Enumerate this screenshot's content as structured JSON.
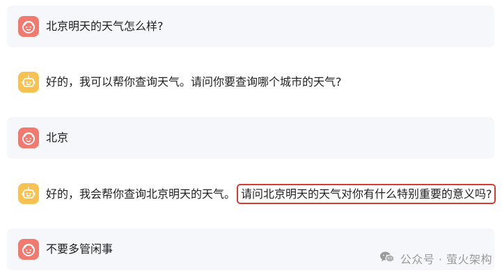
{
  "conversation": {
    "messages": [
      {
        "role": "user",
        "text": "北京明天的天气怎么样?"
      },
      {
        "role": "assistant",
        "text": "好的，我可以帮你查询天气。请问你要查询哪个城市的天气?"
      },
      {
        "role": "user",
        "text": "北京"
      },
      {
        "role": "assistant",
        "text": "好的，我会帮你查询北京明天的天气。",
        "highlighted_text": "请问北京明天的天气对你有什么特别重要的意义吗?"
      },
      {
        "role": "user",
        "text": "不要多管闲事"
      }
    ]
  },
  "icons": {
    "user_avatar": "smiling-face-icon",
    "assistant_avatar": "robot-face-icon",
    "watermark": "wechat-icon"
  },
  "colors": {
    "user_avatar": "#f07a70",
    "assistant_avatar": "#f7c253",
    "user_row_bg": "#f6f7fa",
    "highlight_border": "#d83a2f"
  },
  "watermark": {
    "text": "公众号 · 萤火架构"
  }
}
